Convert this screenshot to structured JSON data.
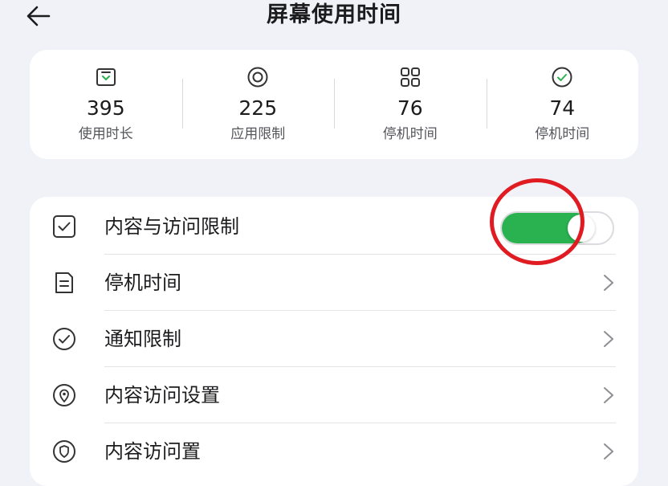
{
  "header": {
    "back_icon": "back-arrow-icon",
    "title": "屏幕使用时间"
  },
  "stats": [
    {
      "icon": "download-box-icon",
      "value": "395",
      "label": "使用时长"
    },
    {
      "icon": "target-circle-icon",
      "value": "225",
      "label": "应用限制"
    },
    {
      "icon": "four-squares-icon",
      "value": "76",
      "label": "停机时间"
    },
    {
      "icon": "check-circle-icon",
      "value": "74",
      "label": "停机时间"
    }
  ],
  "list": {
    "items": [
      {
        "icon": "checkbox-icon",
        "label": "内容与访问限制",
        "control": "toggle",
        "toggle_on": true
      },
      {
        "icon": "document-icon",
        "label": "停机时间",
        "control": "chevron"
      },
      {
        "icon": "check-circle-icon",
        "label": "通知限制",
        "control": "chevron"
      },
      {
        "icon": "location-pin-icon",
        "label": "内容访问设置",
        "control": "chevron"
      },
      {
        "icon": "shield-icon",
        "label": "内容访问置",
        "control": "chevron"
      }
    ]
  },
  "colors": {
    "background": "#f1f2f7",
    "toggle_on": "#2ab150",
    "highlight": "#e01b22"
  }
}
